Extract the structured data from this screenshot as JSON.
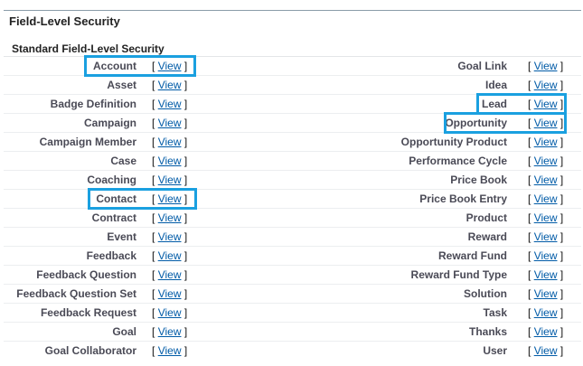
{
  "section_title": "Field-Level Security",
  "sub_title": "Standard Field-Level Security",
  "view_label": "View",
  "bracket_open": "[",
  "bracket_close": "]",
  "left_items": [
    "Account",
    "Asset",
    "Badge Definition",
    "Campaign",
    "Campaign Member",
    "Case",
    "Coaching",
    "Contact",
    "Contract",
    "Event",
    "Feedback",
    "Feedback Question",
    "Feedback Question Set",
    "Feedback Request",
    "Goal",
    "Goal Collaborator"
  ],
  "right_items": [
    "Goal Link",
    "Idea",
    "Lead",
    "Opportunity",
    "Opportunity Product",
    "Performance Cycle",
    "Price Book",
    "Price Book Entry",
    "Product",
    "Reward",
    "Reward Fund",
    "Reward Fund Type",
    "Solution",
    "Task",
    "Thanks",
    "User"
  ],
  "highlight_color": "#1aa0e0"
}
